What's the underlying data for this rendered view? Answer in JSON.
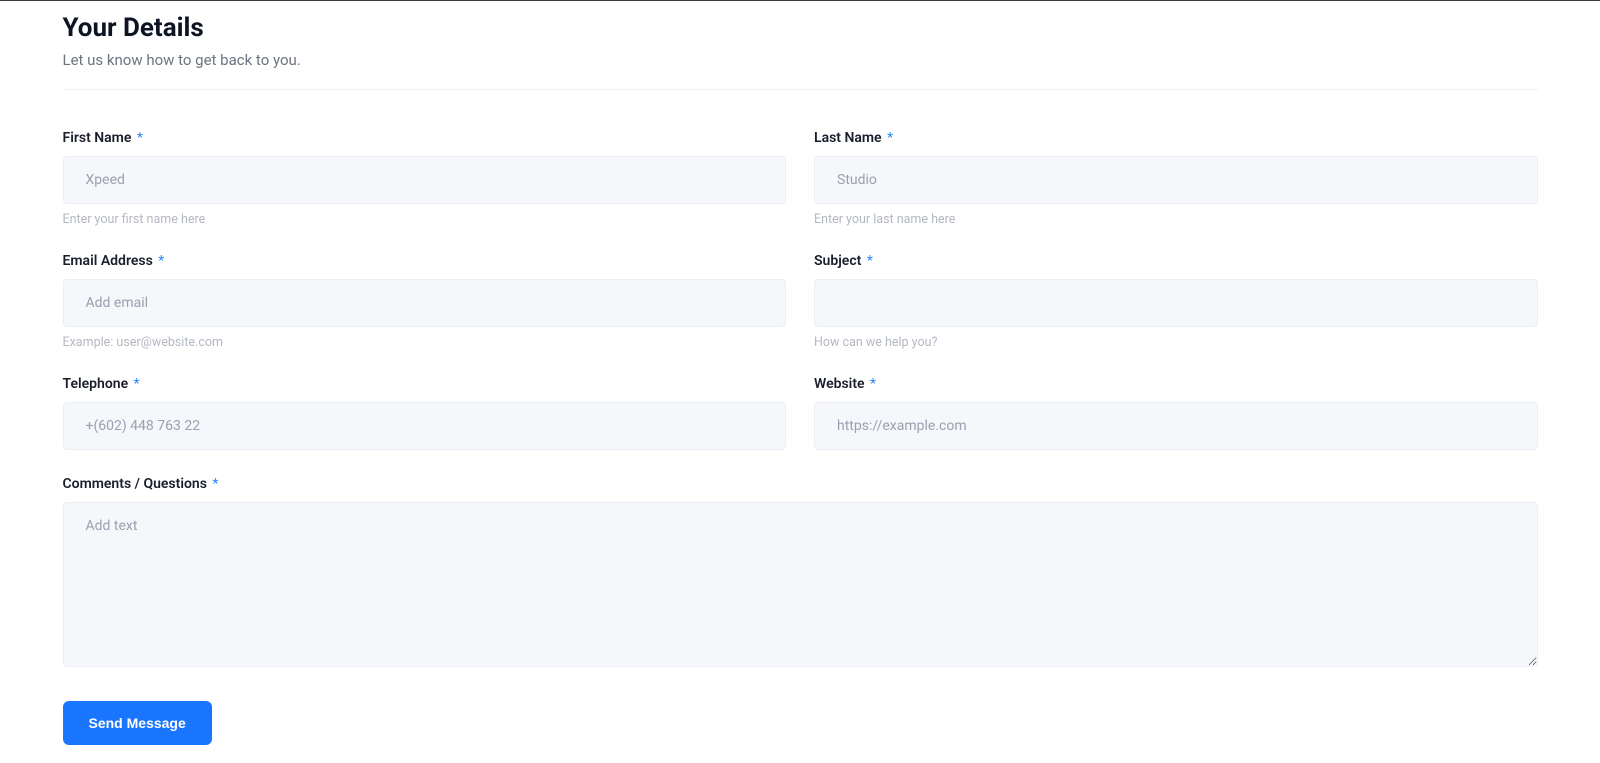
{
  "header": {
    "title": "Your Details",
    "subtitle": "Let us know how to get back to you."
  },
  "required_mark": "*",
  "fields": {
    "first_name": {
      "label": "First Name",
      "placeholder": "Xpeed",
      "help": "Enter your first name here"
    },
    "last_name": {
      "label": "Last Name",
      "placeholder": "Studio",
      "help": "Enter your last name here"
    },
    "email": {
      "label": "Email Address",
      "placeholder": "Add email",
      "help": "Example: user@website.com"
    },
    "subject": {
      "label": "Subject",
      "placeholder": "",
      "help": "How can we help you?"
    },
    "telephone": {
      "label": "Telephone",
      "placeholder": "+(602) 448 763 22"
    },
    "website": {
      "label": "Website",
      "placeholder": "https://example.com"
    },
    "comments": {
      "label": "Comments / Questions",
      "placeholder": "Add text"
    }
  },
  "actions": {
    "submit_label": "Send Message"
  }
}
